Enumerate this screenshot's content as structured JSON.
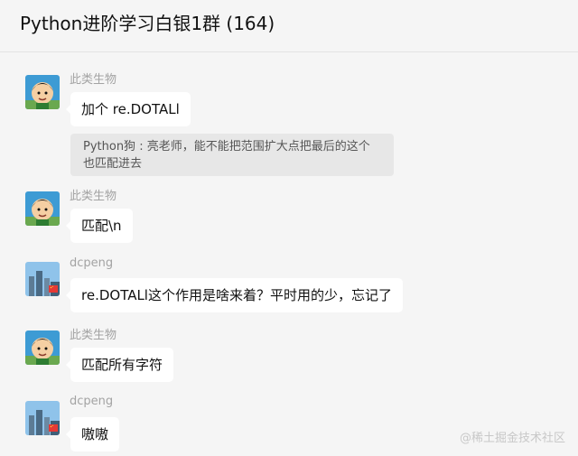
{
  "window": {
    "title": "Python进阶学习白银1群 (164)"
  },
  "messages": [
    {
      "sender": "此类生物",
      "text": "加个 re.DOTALl"
    },
    {
      "quote": "Python狗 : 亮老师，能不能把范围扩大点把最后的这个也匹配进去"
    },
    {
      "sender": "此类生物",
      "text": "匹配\\n"
    },
    {
      "sender": "dcpeng",
      "text": "re.DOTALl这个作用是啥来着？平时用的少，忘记了"
    },
    {
      "sender": "此类生物",
      "text": "匹配所有字符"
    },
    {
      "sender": "dcpeng",
      "text": "嗷嗷"
    }
  ],
  "watermark": "@稀土掘金技术社区"
}
